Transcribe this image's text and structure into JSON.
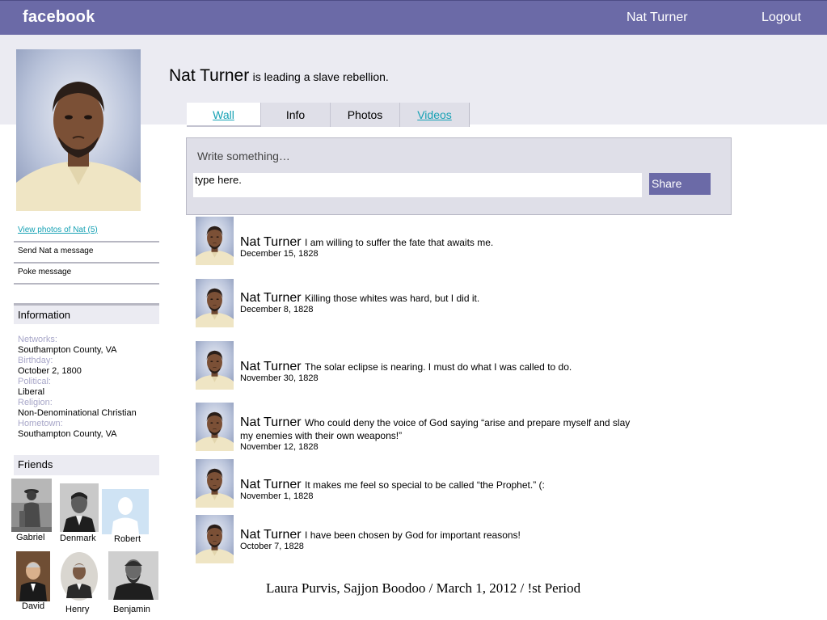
{
  "topbar": {
    "brand": "facebook",
    "profile_name": "Nat Turner",
    "logout": "Logout",
    "color": "#6b6aa7"
  },
  "profile": {
    "name": "Nat Turner",
    "status": "is leading a slave rebellion."
  },
  "tabs": [
    {
      "label": "Wall",
      "active": true,
      "link": true
    },
    {
      "label": "Info",
      "active": false,
      "link": false
    },
    {
      "label": "Photos",
      "active": false,
      "link": false
    },
    {
      "label": "Videos",
      "active": false,
      "link": true
    }
  ],
  "composer": {
    "label": "Write something…",
    "value": "type here.",
    "share": "Share"
  },
  "left_links": [
    {
      "label": "View photos of Nat (5)",
      "link": true
    },
    {
      "label": "Send Nat a message",
      "link": false
    },
    {
      "label": "Poke message",
      "link": false
    }
  ],
  "information": {
    "title": "Information",
    "fields": [
      {
        "label": "Networks:",
        "value": "Southampton County, VA"
      },
      {
        "label": "Birthday:",
        "value": "October 2, 1800"
      },
      {
        "label": "Political:",
        "value": "Liberal"
      },
      {
        "label": "Religion:",
        "value": "Non-Denominational Christian"
      },
      {
        "label": "Hometown:",
        "value": "Southampton County, VA"
      }
    ]
  },
  "friends": {
    "title": "Friends",
    "items": [
      {
        "name": "Gabriel"
      },
      {
        "name": "Denmark"
      },
      {
        "name": "Robert"
      },
      {
        "name": "David"
      },
      {
        "name": "Henry"
      },
      {
        "name": "Benjamin"
      }
    ]
  },
  "posts": [
    {
      "name": "Nat Turner",
      "message": "I am willing to suffer the fate that awaits me.",
      "date": "December 15, 1828"
    },
    {
      "name": "Nat Turner",
      "message": "Killing those whites was hard, but I did it.",
      "date": "December 8, 1828"
    },
    {
      "name": "Nat Turner",
      "message": "The solar eclipse is nearing. I must do what I was called to do.",
      "date": "November 30, 1828"
    },
    {
      "name": "Nat Turner",
      "message": "Who could deny the voice of God saying “arise and prepare myself and slay my enemies with their own weapons!”",
      "date": "November 12, 1828"
    },
    {
      "name": "Nat Turner",
      "message": "It makes me feel so special to be called “the Prophet.” (:",
      "date": "November 1, 1828"
    },
    {
      "name": "Nat Turner",
      "message": "I have been chosen by God for important reasons!",
      "date": "October 7, 1828"
    }
  ],
  "footer": "Laura Purvis, Sajjon Boodoo /  March 1, 2012 /  !st Period"
}
